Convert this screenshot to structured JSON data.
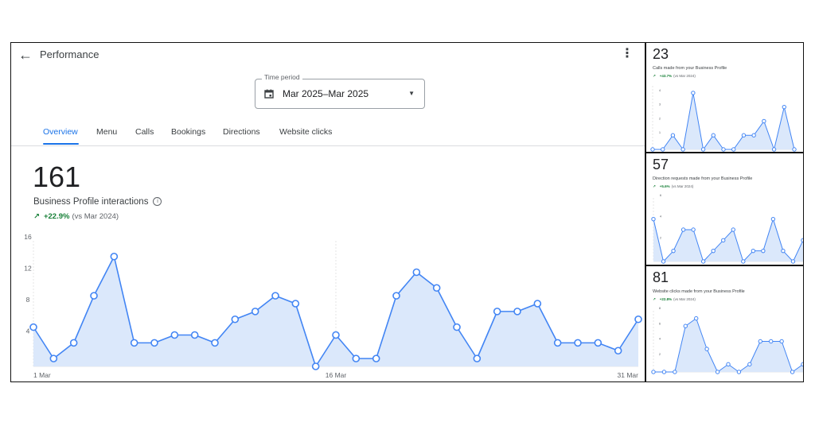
{
  "header": {
    "title": "Performance",
    "back_icon": "arrow-left-icon",
    "menu_icon": "more-vert-icon"
  },
  "time_period": {
    "label": "Time period",
    "value": "Mar 2025–Mar 2025",
    "icon": "calendar-icon",
    "caret_icon": "dropdown-caret-icon"
  },
  "tabs": [
    {
      "label": "Overview",
      "active": true
    },
    {
      "label": "Menu",
      "active": false
    },
    {
      "label": "Calls",
      "active": false
    },
    {
      "label": "Bookings",
      "active": false
    },
    {
      "label": "Directions",
      "active": false
    },
    {
      "label": "Website clicks",
      "active": false
    }
  ],
  "summary": {
    "total": "161",
    "metric_label": "Business Profile interactions",
    "change": "+22.9%",
    "comparison": "(vs Mar 2024)"
  },
  "side_panels": [
    {
      "total": "23",
      "label": "Calls made from your Business Profile",
      "change": "+43.7%",
      "comparison": "(vs Mar 2024)"
    },
    {
      "total": "57",
      "label": "Direction requests made from your Business Profile",
      "change": "+5.6%",
      "comparison": "(vs Mar 2024)"
    },
    {
      "total": "81",
      "label": "Website clicks made from your Business Profile",
      "change": "+22.8%",
      "comparison": "(vs Mar 2024)"
    }
  ],
  "colors": {
    "accent": "#1a73e8",
    "line": "#4285f4",
    "fill": "#dbe8fb",
    "positive": "#188038"
  },
  "chart_data": [
    {
      "type": "area",
      "x_labels": [
        "1 Mar",
        "16 Mar",
        "31 Mar"
      ],
      "y_ticks": [
        4,
        8,
        12,
        16
      ],
      "ylim": [
        0,
        16
      ],
      "grid": false,
      "values": [
        5,
        1,
        3,
        9,
        14,
        3,
        3,
        4,
        4,
        3,
        6,
        7,
        9,
        8,
        0,
        4,
        1,
        1,
        9,
        12,
        10,
        5,
        1,
        7,
        7,
        8,
        3,
        3,
        3,
        2,
        6
      ]
    },
    {
      "type": "area",
      "x_labels": [],
      "y_ticks": [
        1,
        2,
        3,
        4
      ],
      "ylim": [
        0,
        4.5
      ],
      "values": [
        0,
        0,
        1,
        0,
        4,
        0,
        1,
        0,
        0,
        1,
        1,
        2,
        0,
        3,
        0
      ]
    },
    {
      "type": "area",
      "x_labels": [],
      "y_ticks": [
        2,
        4,
        6
      ],
      "ylim": [
        0,
        6
      ],
      "values": [
        4,
        0,
        1,
        3,
        3,
        0,
        1,
        2,
        3,
        0,
        1,
        1,
        4,
        1,
        0,
        2
      ]
    },
    {
      "type": "area",
      "x_labels": [],
      "y_ticks": [
        2,
        4,
        6,
        8
      ],
      "ylim": [
        0,
        8
      ],
      "values": [
        0,
        0,
        0,
        6,
        7,
        3,
        0,
        1,
        0,
        1,
        4,
        4,
        4,
        0,
        1
      ]
    }
  ]
}
